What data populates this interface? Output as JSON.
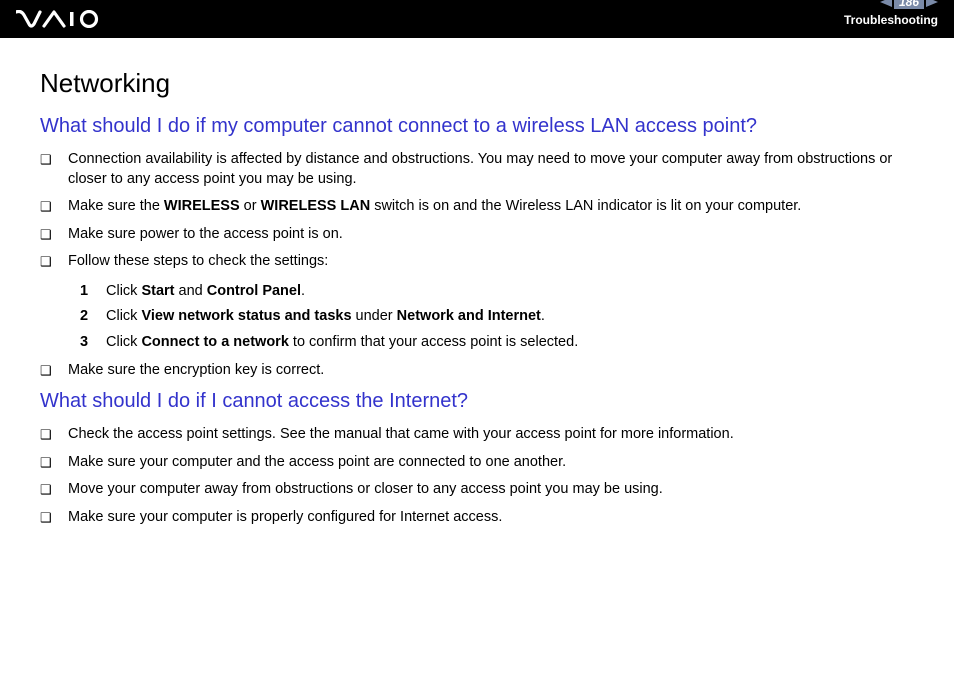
{
  "header": {
    "page_number": "186",
    "section": "Troubleshooting"
  },
  "content": {
    "h1": "Networking",
    "q1": {
      "title": "What should I do if my computer cannot connect to a wireless LAN access point?",
      "bullets": [
        {
          "pre": "Connection availability is affected by distance and obstructions. You may need to move your computer away from obstructions or closer to any access point you may be using."
        },
        {
          "pre": "Make sure the ",
          "b1": "WIRELESS",
          "mid": " or ",
          "b2": "WIRELESS LAN",
          "post": " switch is on and the Wireless LAN indicator is lit on your computer."
        },
        {
          "pre": "Make sure power to the access point is on."
        },
        {
          "pre": "Follow these steps to check the settings:"
        }
      ],
      "steps": [
        {
          "n": "1",
          "pre": "Click ",
          "b1": "Start",
          "mid": " and ",
          "b2": "Control Panel",
          "post": "."
        },
        {
          "n": "2",
          "pre": "Click ",
          "b1": "View network status and tasks",
          "mid": " under ",
          "b2": "Network and Internet",
          "post": "."
        },
        {
          "n": "3",
          "pre": "Click ",
          "b1": "Connect to a network",
          "post": " to confirm that your access point is selected."
        }
      ],
      "bullets2": [
        {
          "pre": "Make sure the encryption key is correct."
        }
      ]
    },
    "q2": {
      "title": "What should I do if I cannot access the Internet?",
      "bullets": [
        {
          "pre": "Check the access point settings. See the manual that came with your access point for more information."
        },
        {
          "pre": "Make sure your computer and the access point are connected to one another."
        },
        {
          "pre": "Move your computer away from obstructions or closer to any access point you may be using."
        },
        {
          "pre": "Make sure your computer is properly configured for Internet access."
        }
      ]
    }
  }
}
